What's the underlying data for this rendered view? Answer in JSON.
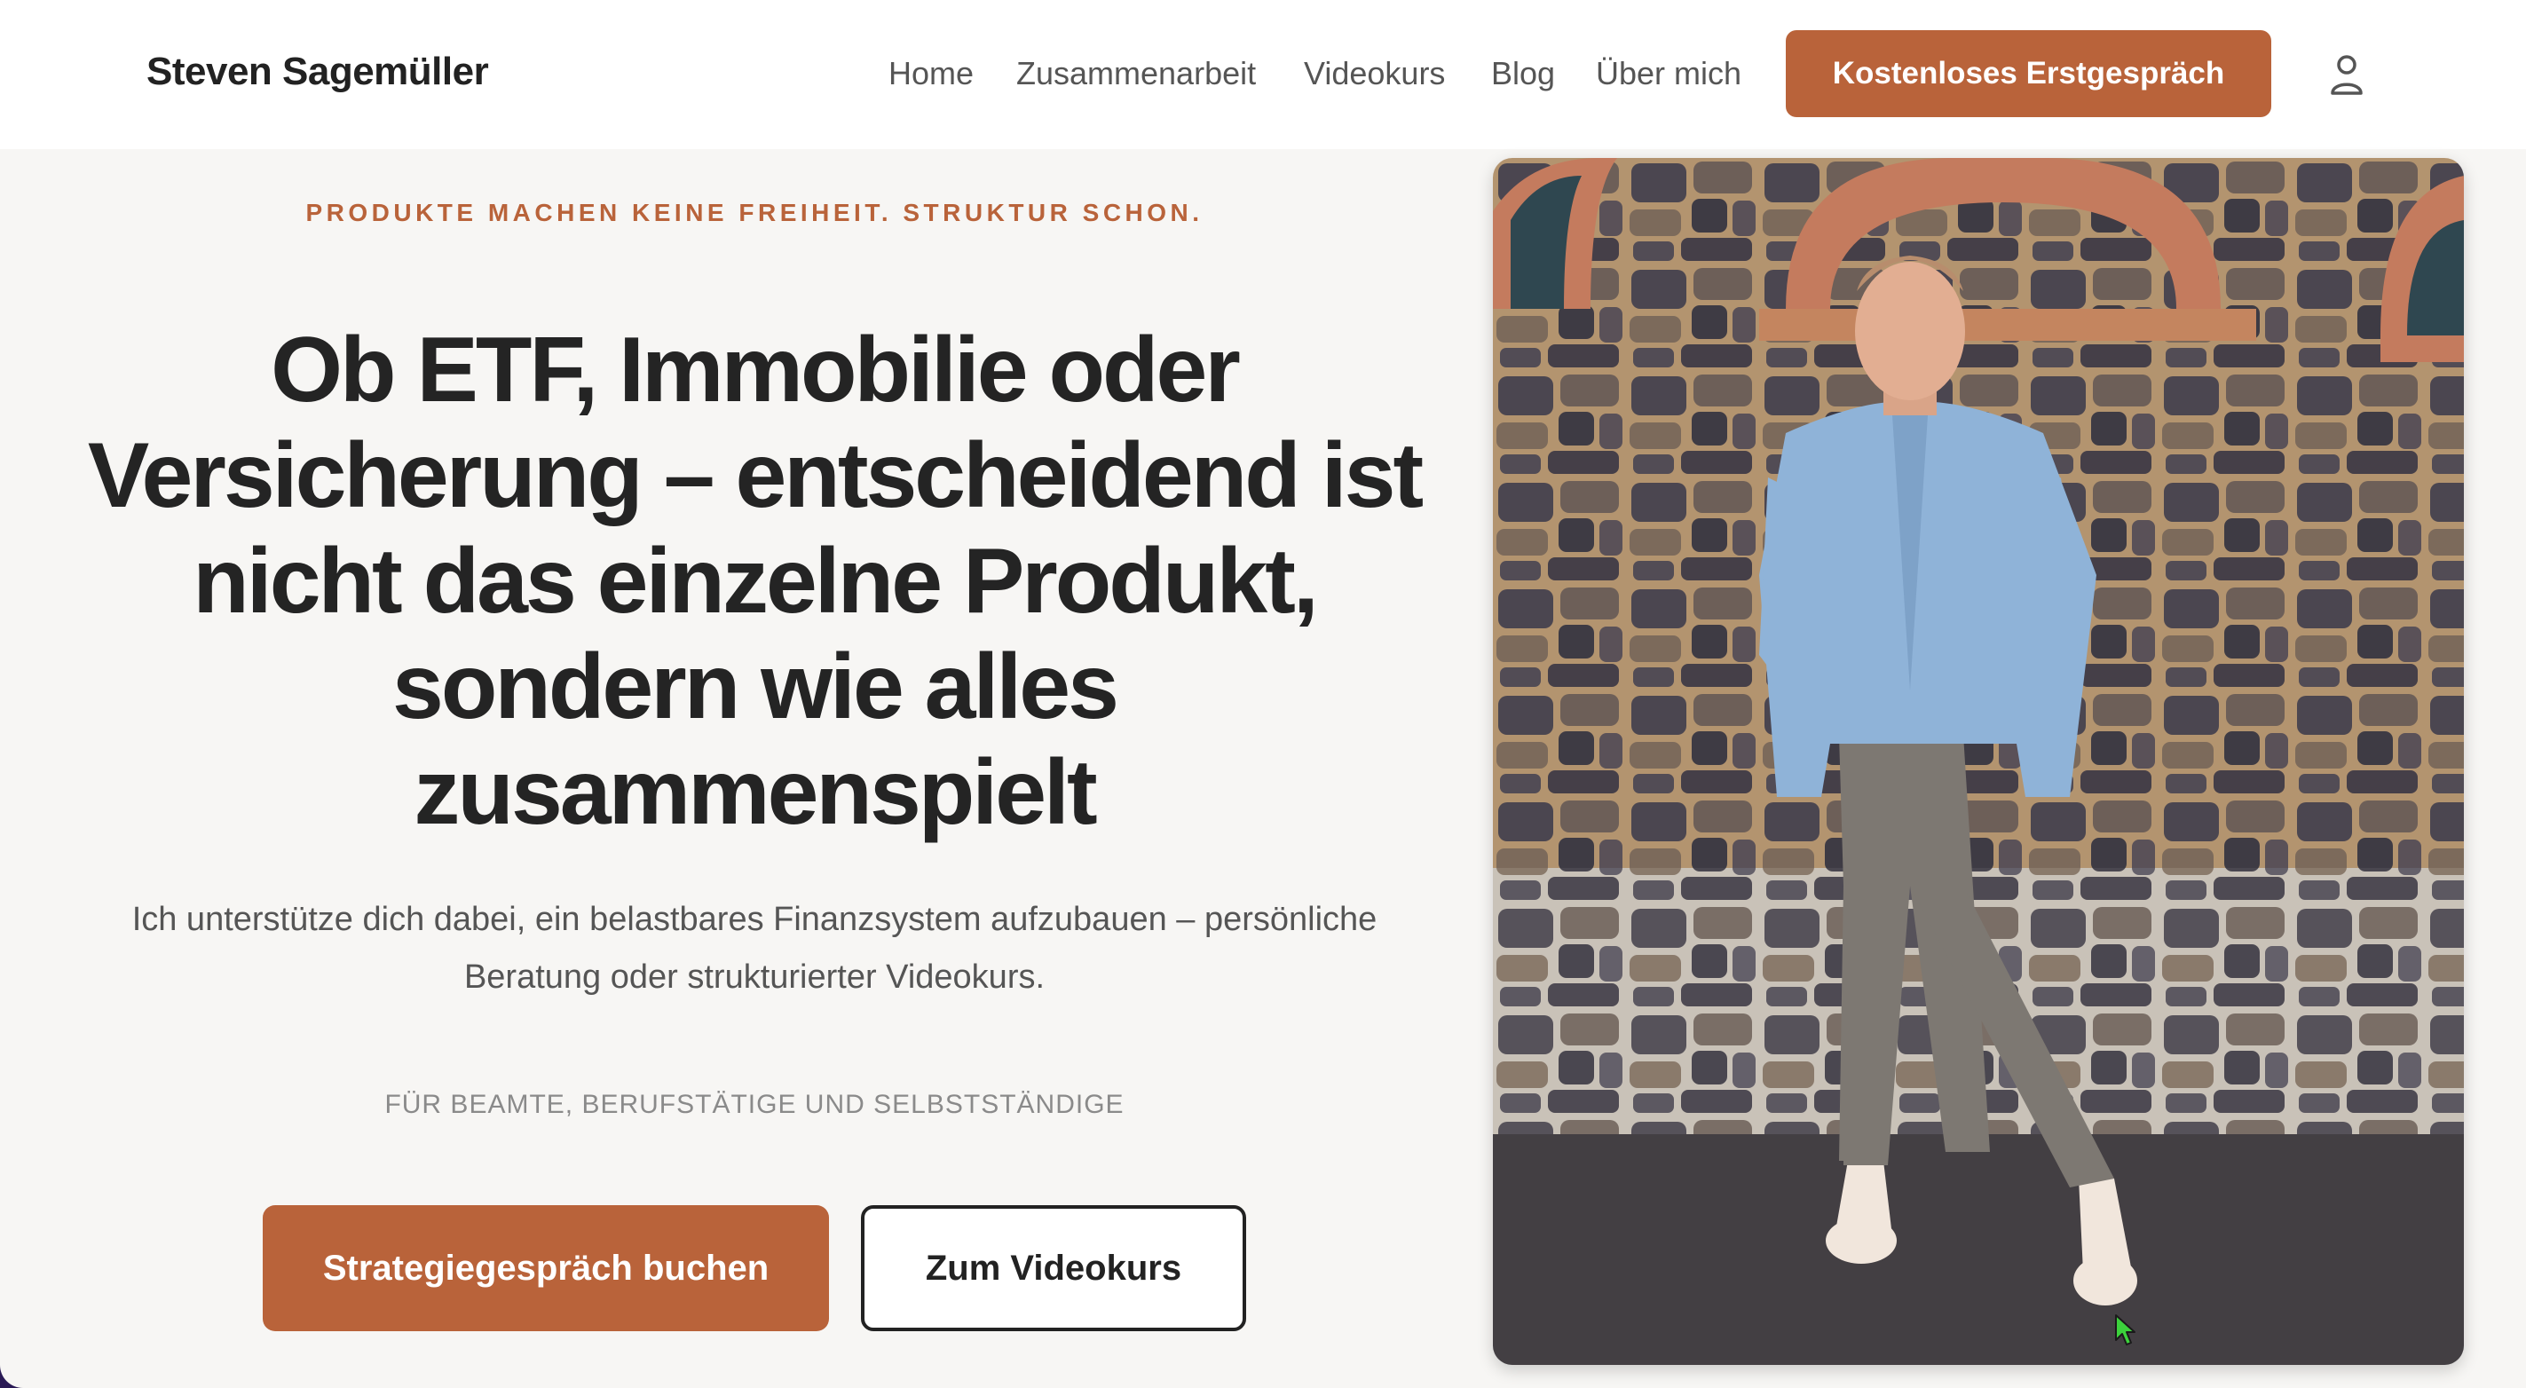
{
  "header": {
    "brand": "Steven Sagemüller",
    "nav": [
      "Home",
      "Zusammenarbeit",
      "Videokurs",
      "Blog",
      "Über mich"
    ],
    "cta_label": "Kostenloses Erstgespräch",
    "account_icon": "user-icon"
  },
  "hero": {
    "eyebrow": "PRODUKTE MACHEN KEINE FREIHEIT. STRUKTUR SCHON.",
    "headline_lines": [
      "Ob ETF, Immobilie oder",
      "Versicherung – entscheidend ist",
      "nicht das einzelne Produkt,",
      "sondern wie alles",
      "zusammenspielt"
    ],
    "subline": "Ich unterstütze dich dabei, ein belastbares Finanzsystem aufzubauen – persönliche Beratung oder strukturierter Videokurs.",
    "audience": "FÜR BEAMTE, BERUFSTÄTIGE UND SELBSTSTÄNDIGE",
    "primary_button": "Strategiegespräch buchen",
    "secondary_button": "Zum Videokurs"
  },
  "colors": {
    "accent": "#b9633a",
    "text_dark": "#242424",
    "text_muted": "#555555",
    "background": "#f7f6f4"
  }
}
